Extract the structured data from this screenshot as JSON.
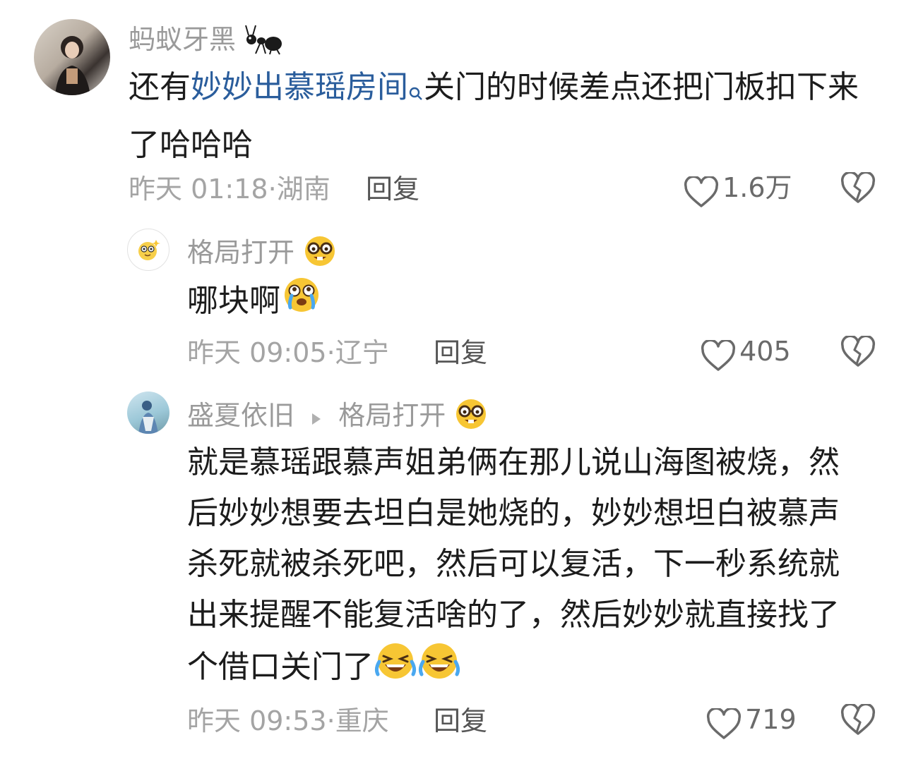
{
  "comments": [
    {
      "username": "蚂蚁牙黑",
      "name_emoji": "ant-emoji",
      "text_before": "还有",
      "link_text": "妙妙出慕瑶房间",
      "text_after": "关门的时候差点还把门板扣下来了哈哈哈",
      "time": "昨天 01:18",
      "location": "湖南",
      "reply_label": "回复",
      "likes": "1.6万"
    },
    {
      "username": "格局打开",
      "name_emoji": "nerd-face-emoji",
      "text": "哪块啊",
      "text_emoji": "tear-eyes-emoji",
      "time": "昨天 09:05",
      "location": "辽宁",
      "reply_label": "回复",
      "likes": "405"
    },
    {
      "username": "盛夏依旧",
      "reply_to": "格局打开",
      "name_emoji": "nerd-face-emoji",
      "text": "就是慕瑶跟慕声姐弟俩在那儿说山海图被烧，然后妙妙想要去坦白是她烧的，妙妙想坦白被慕声杀死就被杀死吧，然后可以复活，下一秒系统就出来提醒不能复活啥的了，然后妙妙就直接找了个借口关门了",
      "text_emoji": "rofl-emoji",
      "time": "昨天 09:53",
      "location": "重庆",
      "reply_label": "回复",
      "likes": "719"
    }
  ],
  "colors": {
    "link": "#2a5d9c",
    "meta": "#a4a4a4",
    "username": "#9a9a9a"
  },
  "icons": [
    "heart-icon",
    "dislike-heart-icon",
    "search-mini-icon",
    "reply-arrow-icon"
  ]
}
